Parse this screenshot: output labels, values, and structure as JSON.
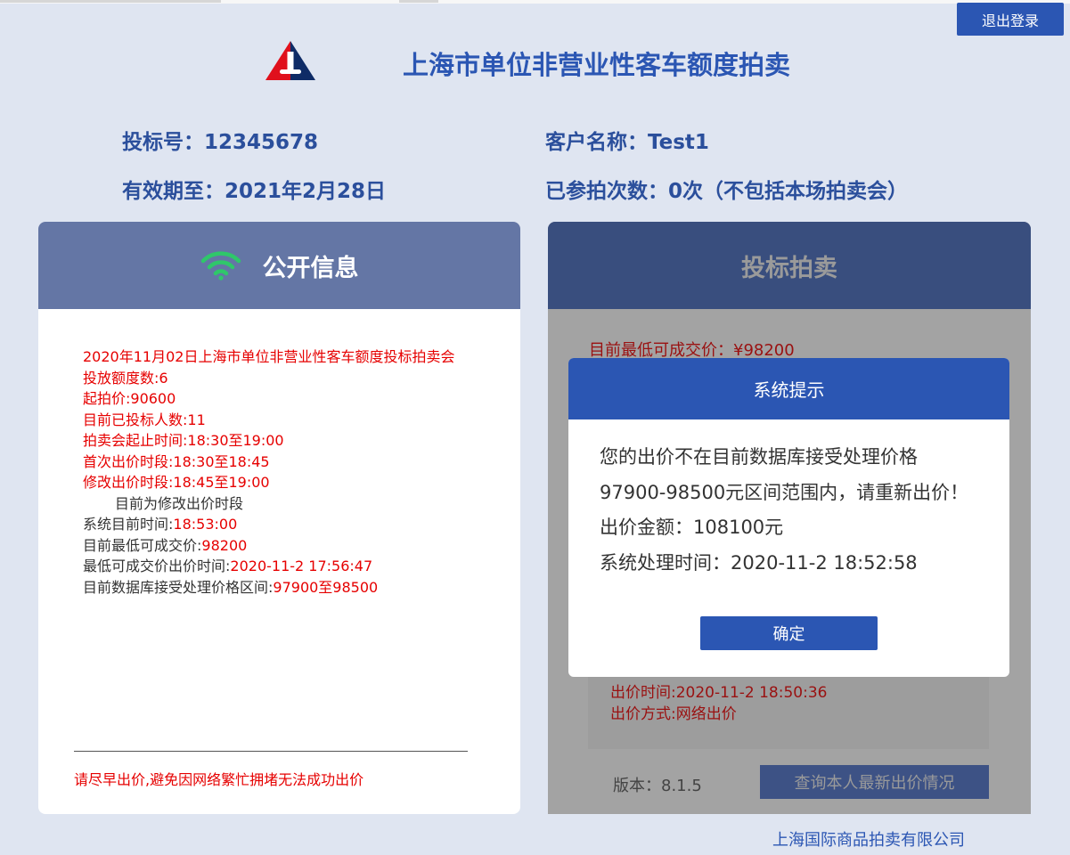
{
  "header": {
    "logout_label": "退出登录",
    "title": "上海市单位非营业性客车额度拍卖"
  },
  "user_info": {
    "bid_number": "投标号：12345678",
    "customer_name": "客户名称：Test1",
    "valid_until": "有效期至：2021年2月28日",
    "participation_count": "已参拍次数：0次（不包括本场拍卖会）"
  },
  "public_info": {
    "title": "公开信息",
    "auction_name": "2020年11月02日上海市单位非营业性客车额度投标拍卖会",
    "quota_label": "投放额度数:6",
    "start_price_label": "起拍价:90600",
    "bidders_label": "目前已投标人数:11",
    "auction_time_label": "拍卖会起止时间:18:30至19:00",
    "first_bid_label": "首次出价时段:18:30至18:45",
    "modify_bid_label": "修改出价时段:18:45至19:00",
    "current_phase": "目前为修改出价时段",
    "system_time_label": "系统目前时间:",
    "system_time_value": "18:53:00",
    "lowest_price_label": "目前最低可成交价:",
    "lowest_price_value": "98200",
    "lowest_price_time_label": "最低可成交价出价时间:",
    "lowest_price_time_value": "2020-11-2 17:56:47",
    "accept_range_label": "目前数据库接受处理价格区间:",
    "accept_range_value": "97900至98500",
    "note": "请尽早出价,避免因网络繁忙拥堵无法成功出价"
  },
  "bidding": {
    "title": "投标拍卖",
    "lowest_price": "目前最低可成交价：¥98200",
    "bid_time": "出价时间:2020-11-2 18:50:36",
    "bid_mode": "出价方式:网络出价",
    "version": "版本：8.1.5",
    "query_button_label": "查询本人最新出价情况"
  },
  "modal": {
    "title": "系统提示",
    "line1": "您的出价不在目前数据库接受处理价格",
    "line2": "97900-98500元区间范围内，请重新出价！",
    "line3": "出价金额：108100元",
    "line4": "系统处理时间：2020-11-2 18:52:58",
    "ok_label": "确定"
  },
  "footer": {
    "company": "上海国际商品拍卖有限公司"
  },
  "colors": {
    "accent": "#2b56b3",
    "public_header": "#6476a5",
    "bidding_header": "#394e7e",
    "alert_red": "#e60000",
    "page_bg": "#dfe5f1"
  }
}
